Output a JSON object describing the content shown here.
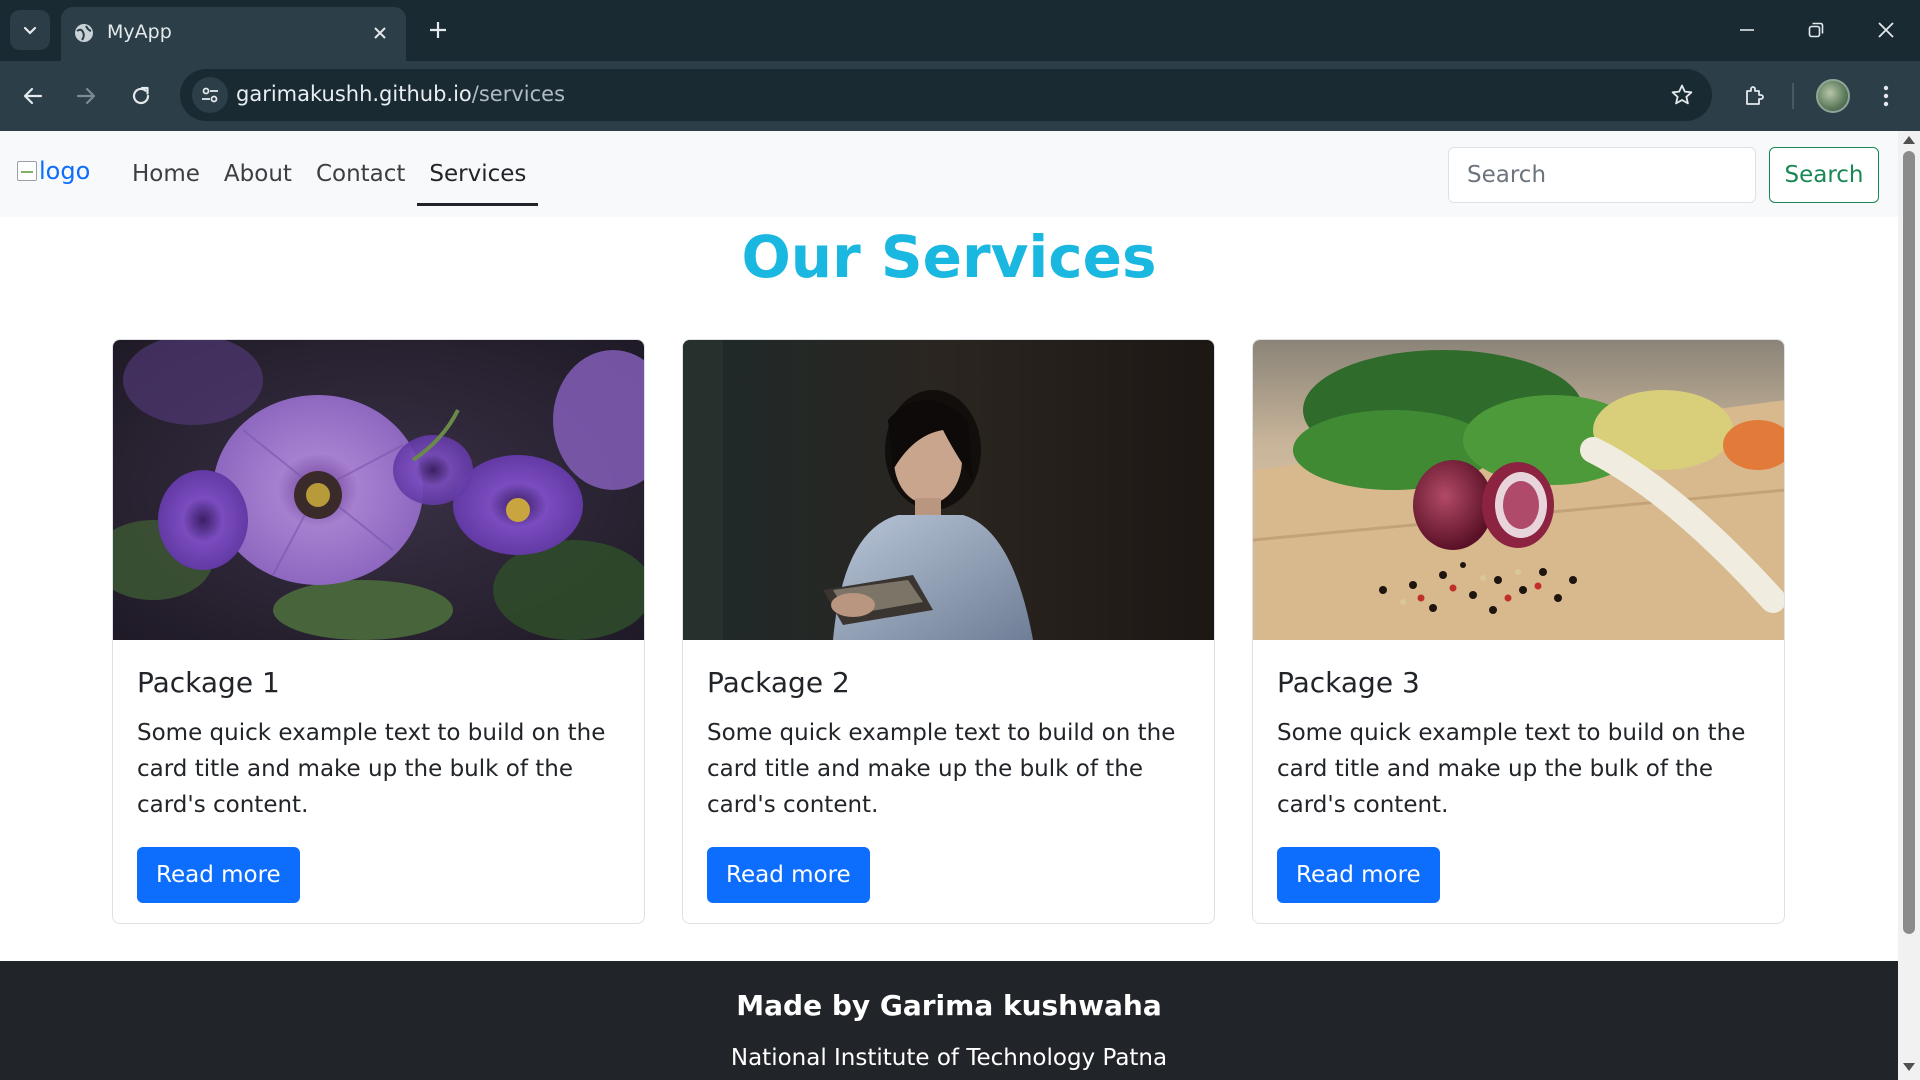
{
  "browser": {
    "tab_title": "MyApp",
    "url_host": "garimakushh.github.io",
    "url_path": "/services",
    "icons": [
      "chevron-down-icon",
      "globe-icon",
      "close-icon",
      "plus-icon",
      "minimize-icon",
      "restore-icon",
      "window-close-icon",
      "back-icon",
      "forward-icon",
      "reload-icon",
      "tune-icon",
      "star-icon",
      "extensions-icon",
      "menu-icon"
    ]
  },
  "site_nav": {
    "logo_alt": "logo",
    "links": [
      {
        "label": "Home"
      },
      {
        "label": "About"
      },
      {
        "label": "Contact"
      },
      {
        "label": "Services",
        "active": true
      }
    ],
    "search_placeholder": "Search",
    "search_button": "Search"
  },
  "main": {
    "title": "Our Services",
    "cards": [
      {
        "title": "Package 1",
        "text": "Some quick example text to build on the card title and make up the bulk of the card's content.",
        "button": "Read more",
        "image": "purple-flowers"
      },
      {
        "title": "Package 2",
        "text": "Some quick example text to build on the card title and make up the bulk of the card's content.",
        "button": "Read more",
        "image": "woman-reading"
      },
      {
        "title": "Package 3",
        "text": "Some quick example text to build on the card title and make up the bulk of the card's content.",
        "button": "Read more",
        "image": "vegetables-on-board"
      }
    ]
  },
  "footer": {
    "title": "Made by Garima kushwaha",
    "subtitle": "National Institute of Technology Patna"
  },
  "colors": {
    "title_accent": "#1ab8e0",
    "primary_button": "#0d6efd",
    "search_button": "#198754",
    "footer_bg": "#212529"
  }
}
